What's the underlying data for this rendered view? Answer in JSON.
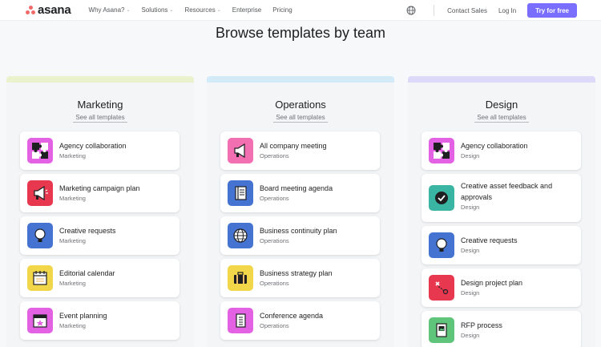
{
  "nav": {
    "logo_text": "asana",
    "items": [
      {
        "label": "Why Asana?",
        "dropdown": true
      },
      {
        "label": "Solutions",
        "dropdown": true
      },
      {
        "label": "Resources",
        "dropdown": true
      },
      {
        "label": "Enterprise",
        "dropdown": false
      },
      {
        "label": "Pricing",
        "dropdown": false
      }
    ],
    "contact_sales": "Contact Sales",
    "login": "Log In",
    "cta": "Try for free"
  },
  "page_title": "Browse templates by team",
  "see_all": "See all templates",
  "colors": {
    "brand": "#f06a6a",
    "cta": "#796eff",
    "marketing_bar": "#eaf1cd",
    "operations_bar": "#d3ebf8",
    "design_bar": "#dcd9fb",
    "magenta": "#e362e3",
    "red": "#e8384f",
    "blue": "#4573d2",
    "yellow": "#f8df72",
    "gold": "#f1bd6c",
    "pink": "#f26fb2",
    "teal": "#3bb5a3",
    "green": "#5fc57a"
  },
  "columns": [
    {
      "title": "Marketing",
      "templates": [
        {
          "title": "Agency collaboration",
          "team": "Marketing",
          "icon": "puzzle-icon"
        },
        {
          "title": "Marketing campaign plan",
          "team": "Marketing",
          "icon": "megaphone-icon"
        },
        {
          "title": "Creative requests",
          "team": "Marketing",
          "icon": "lightbulb-icon"
        },
        {
          "title": "Editorial calendar",
          "team": "Marketing",
          "icon": "notepad-icon"
        },
        {
          "title": "Event planning",
          "team": "Marketing",
          "icon": "calendar-star-icon"
        }
      ]
    },
    {
      "title": "Operations",
      "templates": [
        {
          "title": "All company meeting",
          "team": "Operations",
          "icon": "megaphone-icon"
        },
        {
          "title": "Board meeting agenda",
          "team": "Operations",
          "icon": "notebook-icon"
        },
        {
          "title": "Business continuity plan",
          "team": "Operations",
          "icon": "globe-icon"
        },
        {
          "title": "Business strategy plan",
          "team": "Operations",
          "icon": "briefcase-icon"
        },
        {
          "title": "Conference agenda",
          "team": "Operations",
          "icon": "list-doc-icon"
        }
      ]
    },
    {
      "title": "Design",
      "templates": [
        {
          "title": "Agency collaboration",
          "team": "Design",
          "icon": "puzzle-icon"
        },
        {
          "title": "Creative asset feedback and approvals",
          "team": "Design",
          "icon": "checkmark-icon"
        },
        {
          "title": "Creative requests",
          "team": "Design",
          "icon": "lightbulb-icon"
        },
        {
          "title": "Design project plan",
          "team": "Design",
          "icon": "route-icon"
        },
        {
          "title": "RFP process",
          "team": "Design",
          "icon": "image-doc-icon"
        }
      ]
    }
  ]
}
